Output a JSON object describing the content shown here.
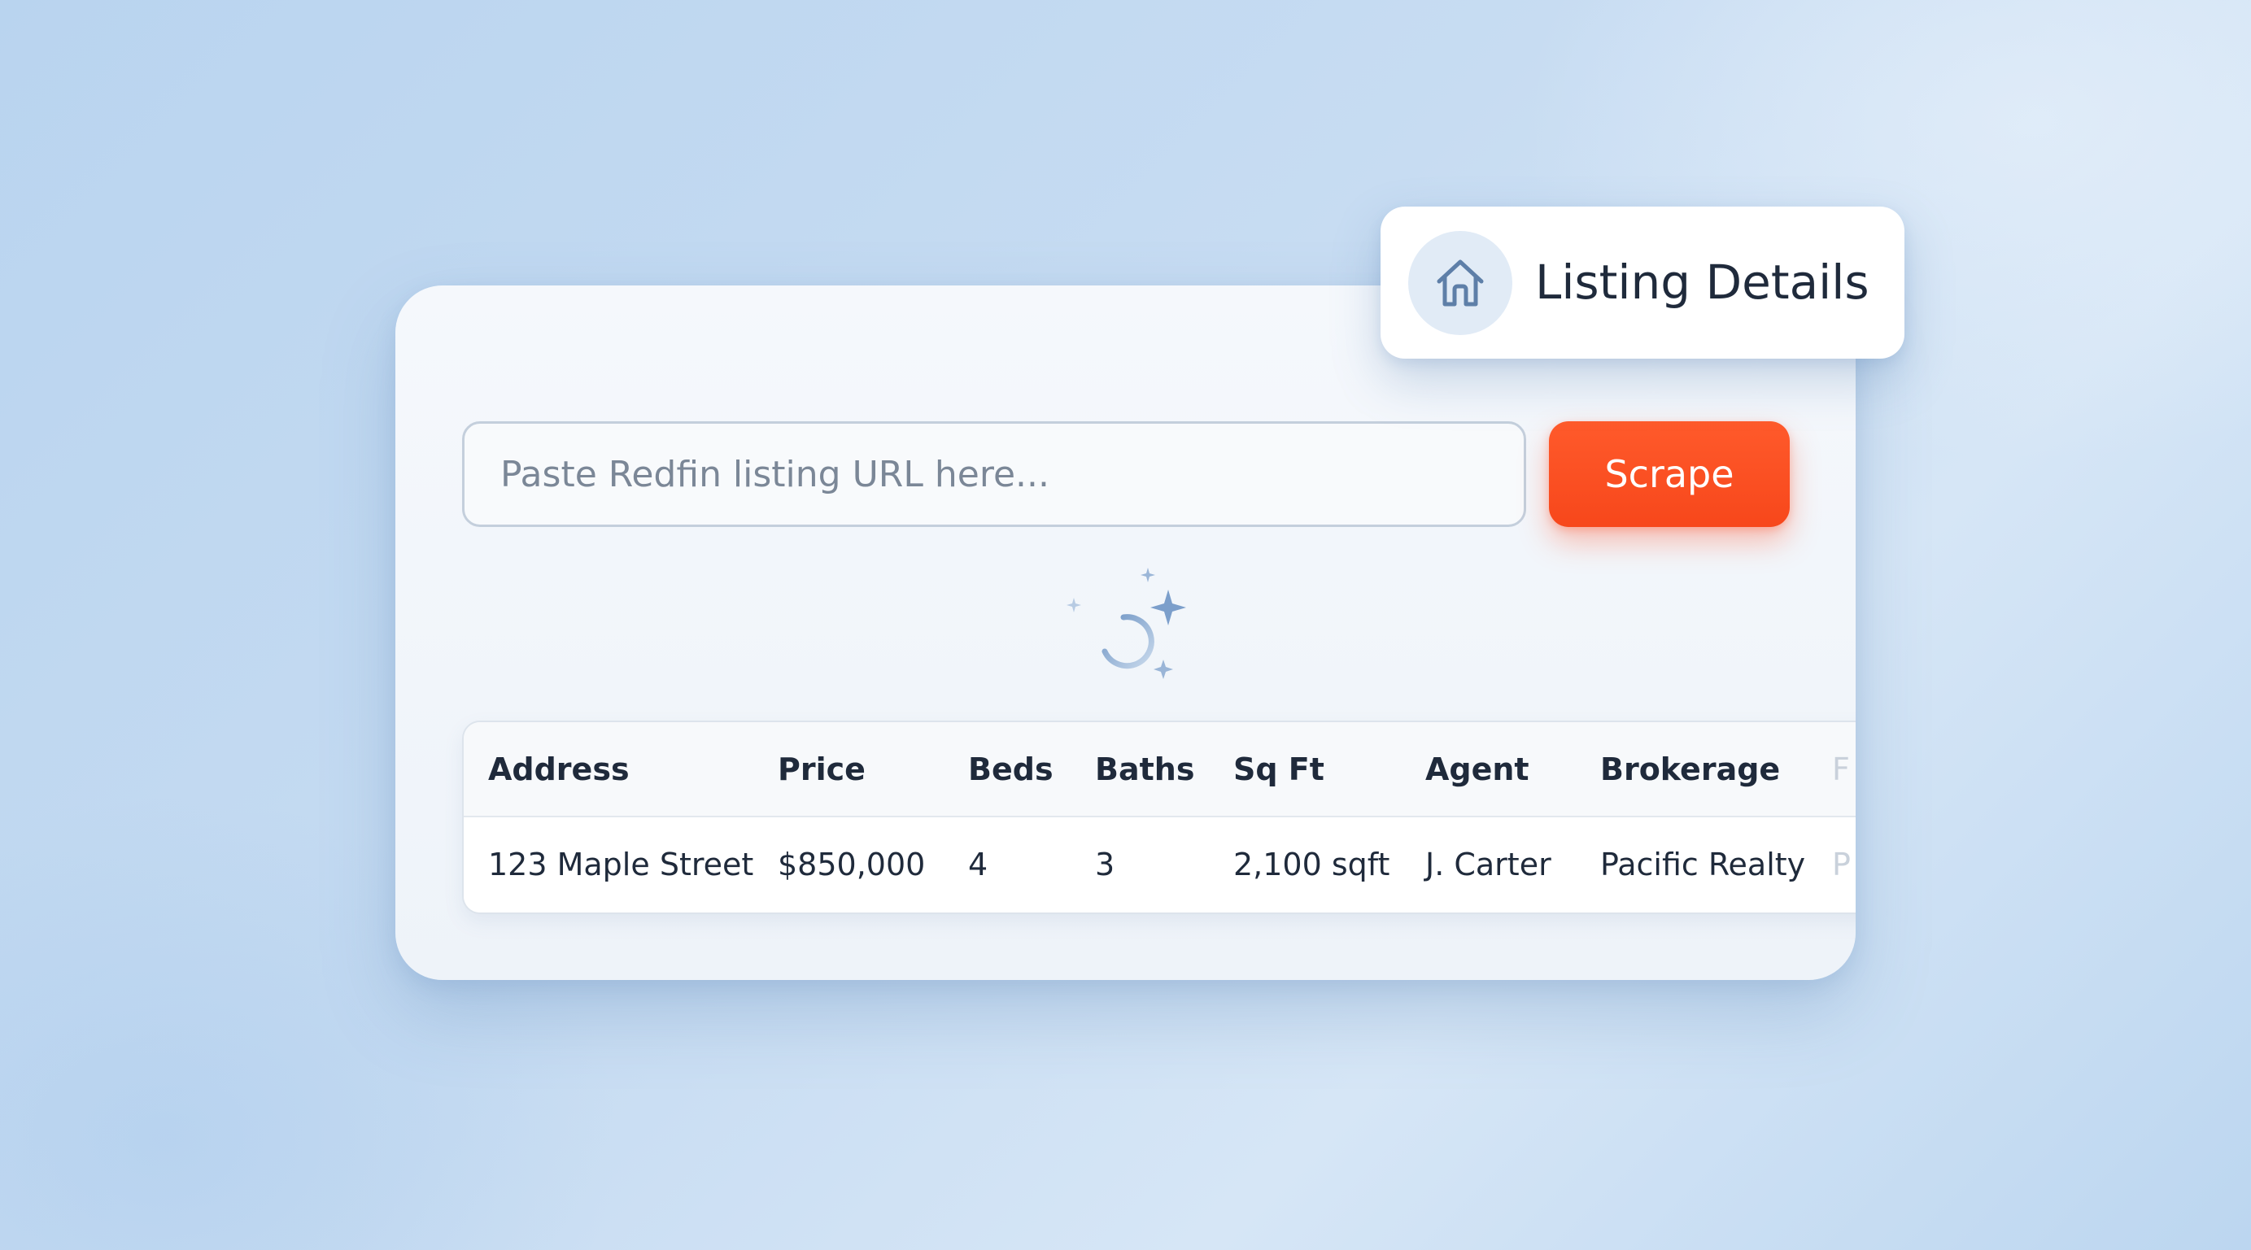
{
  "search": {
    "placeholder": "Paste Redfin listing URL here...",
    "value": ""
  },
  "scrape_button": {
    "label": "Scrape"
  },
  "listing_badge": {
    "title": "Listing Details",
    "icon": "home-icon"
  },
  "loading": {
    "icon": "sparkle-spinner-icon"
  },
  "table": {
    "columns": [
      "Address",
      "Price",
      "Beds",
      "Baths",
      "Sq Ft",
      "Agent",
      "Brokerage",
      "F"
    ],
    "rows": [
      [
        "123 Maple Street",
        "$850,000",
        "4",
        "3",
        "2,100 sqft",
        "J. Carter",
        "Pacific Realty",
        "P"
      ]
    ]
  },
  "colors": {
    "accent": "#F7471B",
    "background": "#C7DCF2",
    "text": "#1F2A3B",
    "icon": "#5E7FA8"
  }
}
